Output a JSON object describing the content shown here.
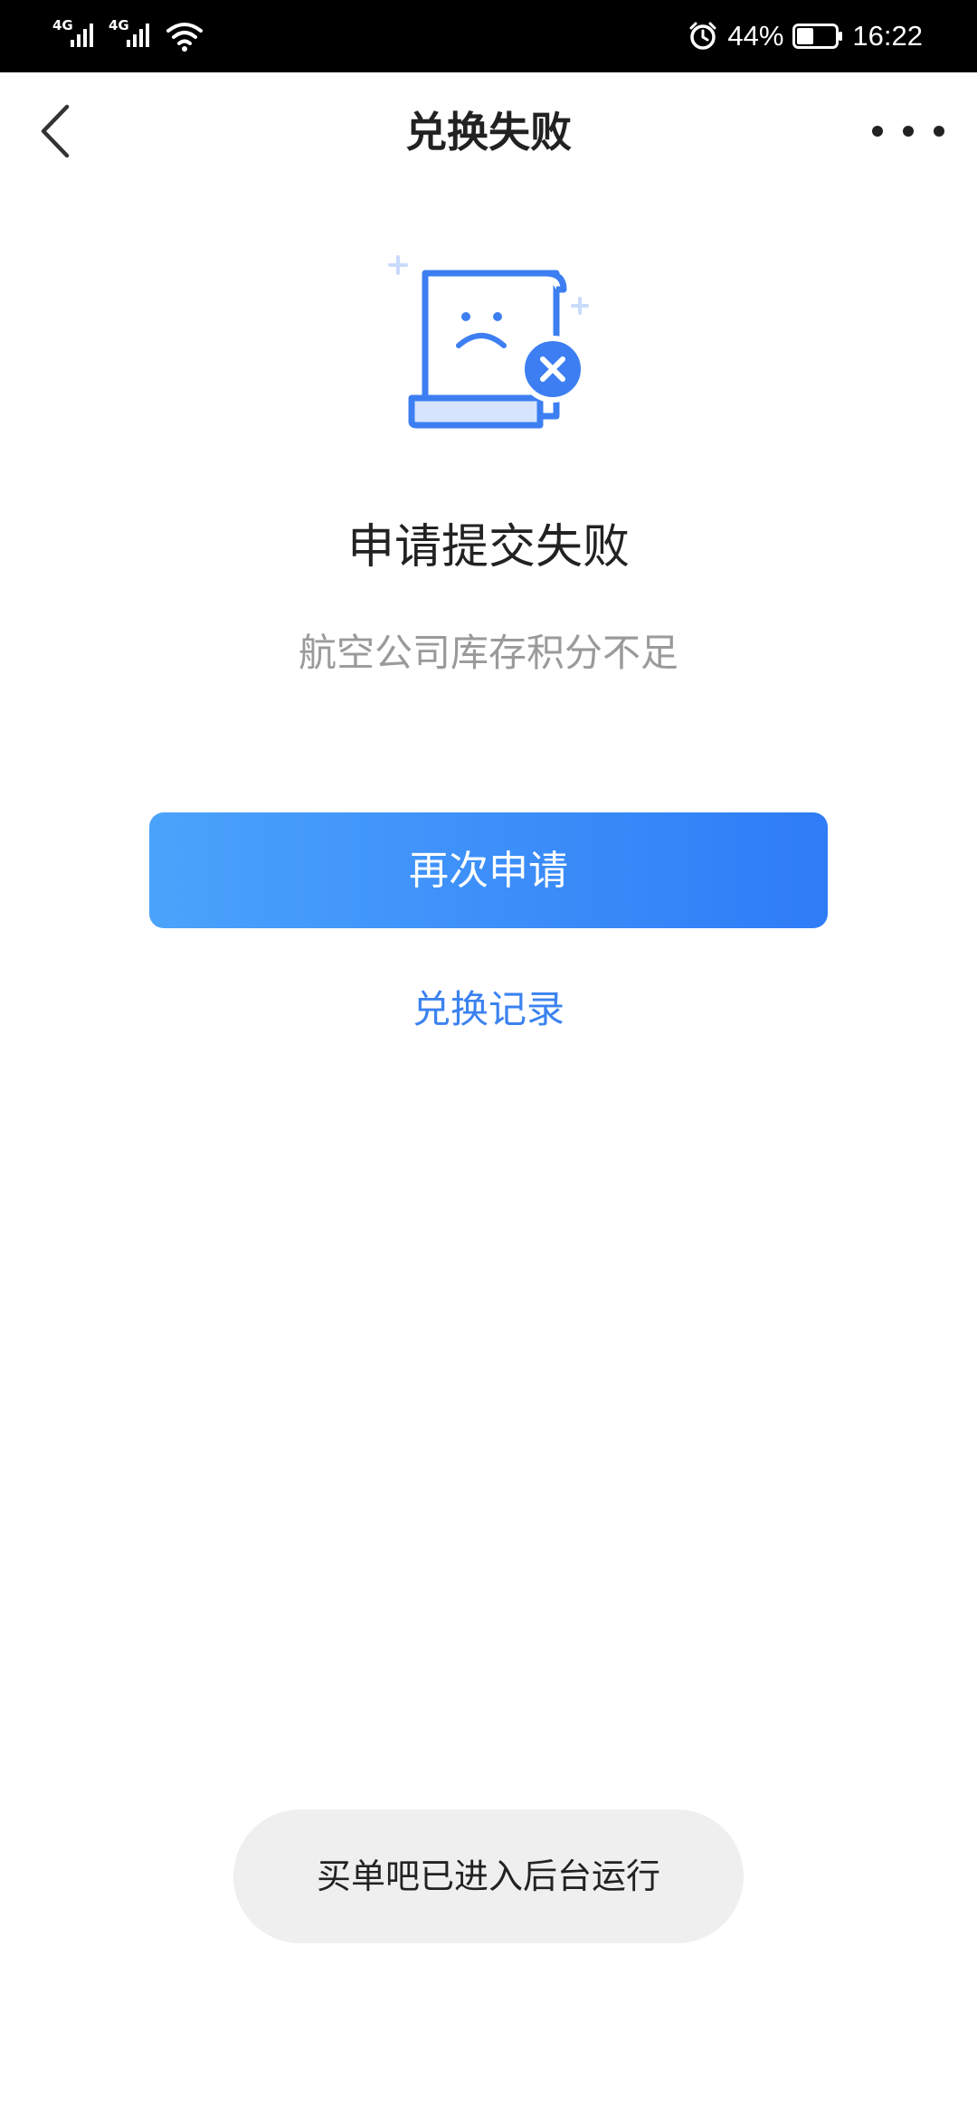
{
  "status_bar": {
    "sim1_network": "4G",
    "sim2_network": "4G",
    "battery_percent": "44%",
    "battery_level": 0.44,
    "time": "16:22",
    "icons": [
      "signal-icon",
      "wifi-icon",
      "alarm-icon",
      "battery-icon"
    ]
  },
  "nav": {
    "title": "兑换失败",
    "back_icon": "chevron-left-icon",
    "more_icon": "more-dots-icon"
  },
  "result": {
    "illustration_icon": "failed-document-icon",
    "title": "申请提交失败",
    "reason": "航空公司库存积分不足"
  },
  "actions": {
    "retry_label": "再次申请",
    "history_label": "兑换记录"
  },
  "toast": {
    "message": "买单吧已进入后台运行"
  },
  "colors": {
    "accent": "#3b82f0",
    "button_gradient_start": "#4ba3fb",
    "button_gradient_end": "#2f7cf7",
    "illustration_blue": "#3d7ff2"
  }
}
